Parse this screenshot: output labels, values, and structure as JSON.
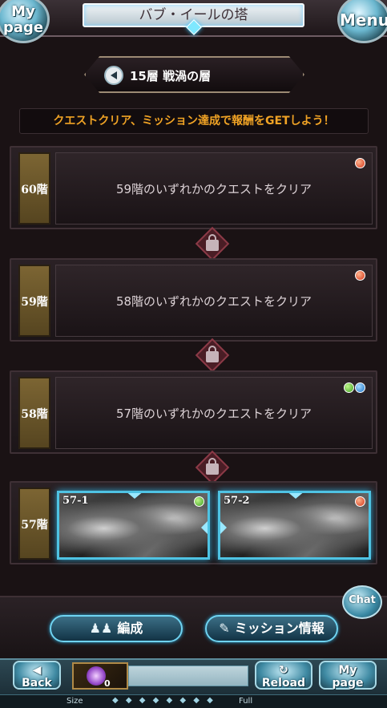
{
  "header": {
    "title": "バブ・イールの塔",
    "mypage_label": "My page",
    "menu_label": "Menu"
  },
  "floor": {
    "name": "15層 戦渦の層"
  },
  "banner": "クエストクリア、ミッション達成で報酬をGETしよう！",
  "rows": [
    {
      "floor": "60階",
      "condition": "59階のいずれかのクエストをクリア",
      "elements": [
        "fire"
      ]
    },
    {
      "floor": "59階",
      "condition": "58階のいずれかのクエストをクリア",
      "elements": [
        "fire"
      ]
    },
    {
      "floor": "58階",
      "condition": "57階のいずれかのクエストをクリア",
      "elements": [
        "wind",
        "water"
      ]
    }
  ],
  "row57": {
    "floor": "57階",
    "quests": [
      {
        "id": "57-1",
        "element": "wind"
      },
      {
        "id": "57-2",
        "element": "fire"
      }
    ]
  },
  "actions": {
    "party_label": "編成",
    "mission_label": "ミッション情報",
    "chat_label": "Chat"
  },
  "footer": {
    "back_label": "Back",
    "item_count": "0",
    "reload_label": "Reload",
    "mypage_label": "My page",
    "size_label": "Size",
    "full_label": "Full"
  },
  "colors": {
    "banner_text": "#f0a325",
    "card_border": "#4fc3e3",
    "row_label_gold": "#7c6533"
  }
}
